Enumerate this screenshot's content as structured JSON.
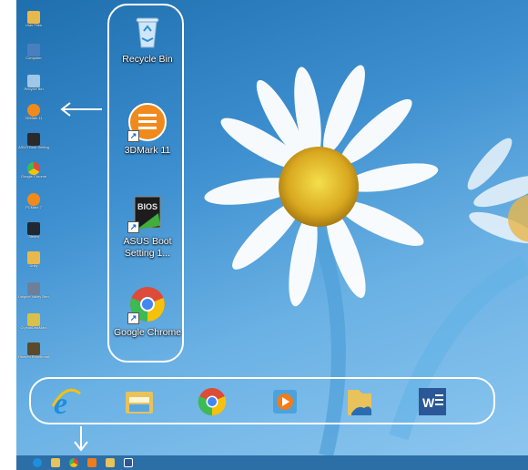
{
  "desktop": {
    "icons": [
      {
        "name": "recycle-bin",
        "label": "Recycle Bin"
      },
      {
        "name": "3dmark-11",
        "label": "3DMark 11"
      },
      {
        "name": "asus-boot-setting",
        "label": "ASUS Boot Setting 1..."
      },
      {
        "name": "google-chrome",
        "label": "Google Chrome"
      }
    ],
    "small_icons": [
      {
        "label": "User Files",
        "icon": "folder-icon",
        "color": "#e8b94a"
      },
      {
        "label": "Computer",
        "icon": "computer-icon",
        "color": "#4a7fbf"
      },
      {
        "label": "Recycle Bin",
        "icon": "recycle-bin-icon",
        "color": "#9fc7e8"
      },
      {
        "label": "3DMark 11",
        "icon": "3dmark-icon",
        "color": "#f08a1d"
      },
      {
        "label": "ASUS Boot Setting",
        "icon": "asus-bios-icon",
        "color": "#2a2a2a"
      },
      {
        "label": "Google Chrome",
        "icon": "chrome-icon",
        "color": "#dd4b39"
      },
      {
        "label": "PCMark 7",
        "icon": "pcmark-icon",
        "color": "#f08a1d"
      },
      {
        "label": "Steam",
        "icon": "steam-icon",
        "color": "#222831"
      },
      {
        "label": "Unity",
        "icon": "unity-icon",
        "color": "#e8b94a"
      },
      {
        "label": "Unigine Valley Bench",
        "icon": "valley-icon",
        "color": "#6e7f9a"
      },
      {
        "label": "CrystalDiskMark",
        "icon": "crystaldisk-icon",
        "color": "#d9c04a"
      },
      {
        "label": "Heaven Benchmark",
        "icon": "heaven-icon",
        "color": "#5b4a2a"
      }
    ]
  },
  "taskbar": {
    "pinned": [
      {
        "name": "internet-explorer",
        "icon": "internet-explorer-icon",
        "color": "#1d8ee0"
      },
      {
        "name": "file-explorer",
        "icon": "file-explorer-icon",
        "color": "#e8c25a"
      },
      {
        "name": "chrome",
        "icon": "chrome-icon",
        "color": "#dd4b39"
      },
      {
        "name": "media-player",
        "icon": "media-player-icon",
        "color": "#f07c1b"
      },
      {
        "name": "skydrive-folder",
        "icon": "skydrive-folder-icon",
        "color": "#e8c25a"
      },
      {
        "name": "word",
        "icon": "word-icon",
        "color": "#2b5797"
      }
    ]
  },
  "colors": {
    "desktop_bg": "#3c8ecf",
    "taskbar_bg": "#2c6ea6",
    "highlight": "#ffffff"
  }
}
